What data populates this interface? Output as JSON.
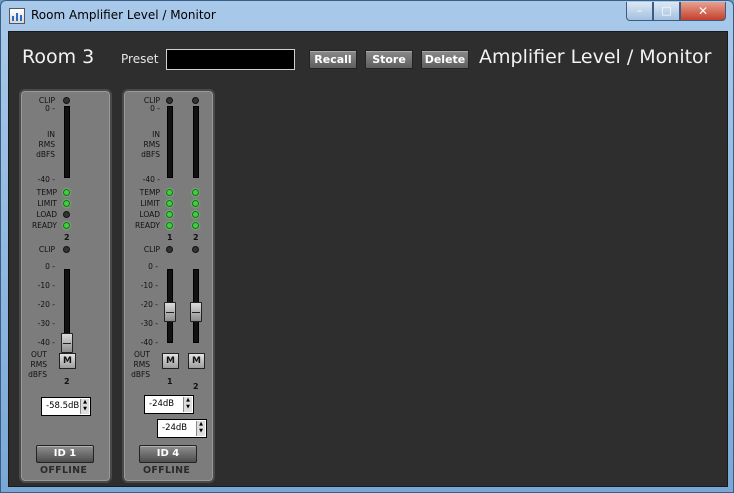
{
  "window": {
    "title": "Room Amplifier Level / Monitor",
    "min_glyph": "–",
    "max_glyph": "□",
    "close_glyph": "✕"
  },
  "toolbar": {
    "room": "Room 3",
    "preset_label": "Preset",
    "preset_value": "",
    "recall_label": "Recall",
    "store_label": "Store",
    "delete_label": "Delete",
    "heading": "Amplifier Level / Monitor"
  },
  "labels": {
    "clip": "CLIP",
    "zero": "0 -",
    "in": "IN",
    "rms": "RMS",
    "dbfs": "dBFS",
    "minus40": "-40 -",
    "temp": "TEMP",
    "limit": "LIMIT",
    "load": "LOAD",
    "ready": "READY",
    "out": "OUT",
    "m10": "-10 -",
    "m20": "-20 -",
    "m30": "-30 -",
    "mute": "M",
    "up": "▲",
    "down": "▼"
  },
  "strips": [
    {
      "id_label": "ID 1",
      "status": "OFFLINE",
      "input_channels": [
        "2"
      ],
      "output_channels": [
        "2"
      ],
      "gains": [
        "-58.5dB"
      ],
      "leds": {
        "temp": "green",
        "limit": "green",
        "load": "off",
        "ready": "green"
      },
      "fader_levels_db": [
        -40
      ]
    },
    {
      "id_label": "ID 4",
      "status": "OFFLINE",
      "input_channels": [
        "1",
        "2"
      ],
      "output_channels": [
        "1",
        "2"
      ],
      "gains": [
        "-24dB",
        "-24dB"
      ],
      "leds": {
        "temp": "green",
        "limit": "green",
        "load": "green",
        "ready": "green"
      },
      "fader_levels_db": [
        -24,
        -24
      ]
    }
  ],
  "colors": {
    "background": "#2e2e2e",
    "led_on": "#3fcf3f",
    "strip": "#7c7c7c"
  }
}
